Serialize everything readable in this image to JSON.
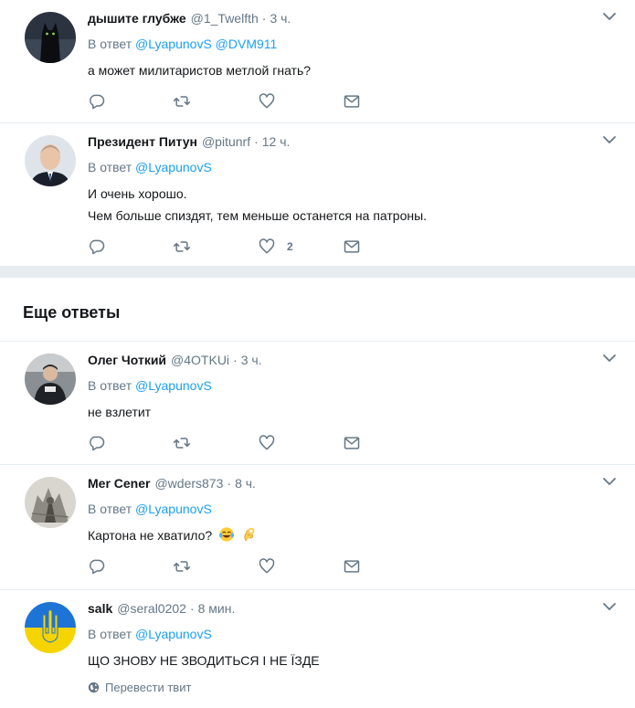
{
  "tweets_top": [
    {
      "fullname": "дышите глубже",
      "username": "@1_Twelfth",
      "time": "3 ч.",
      "reply_prefix": "В ответ",
      "mentions": [
        "@LyapunovS",
        "@DVM911"
      ],
      "text_lines": [
        "а может милитаристов метлой гнать?"
      ],
      "avatar_icon": "black-cat-avatar",
      "like_count": ""
    },
    {
      "fullname": "Президент Питун",
      "username": "@pitunrf",
      "time": "12 ч.",
      "reply_prefix": "В ответ",
      "mentions": [
        "@LyapunovS"
      ],
      "text_lines": [
        "И очень хорошо.",
        "Чем больше спиздят, тем меньше останется на патроны."
      ],
      "avatar_icon": "portrait-avatar",
      "like_count": "2"
    }
  ],
  "more_replies_title": "Еще ответы",
  "tweets_more": [
    {
      "fullname": "Олег Чоткий",
      "username": "@4OTKUi",
      "time": "3 ч.",
      "reply_prefix": "В ответ",
      "mentions": [
        "@LyapunovS"
      ],
      "text_lines": [
        "не взлетит"
      ],
      "avatar_icon": "person-photo-avatar",
      "like_count": ""
    },
    {
      "fullname": "Mer Cener",
      "username": "@wders873",
      "time": "8 ч.",
      "reply_prefix": "В ответ",
      "mentions": [
        "@LyapunovS"
      ],
      "text_lines": [
        "Картона не хватило?"
      ],
      "emojis": [
        "tears-of-joy-emoji",
        "ok-hand-emoji"
      ],
      "avatar_icon": "engraving-avatar",
      "like_count": ""
    },
    {
      "fullname": "salk",
      "username": "@seral0202",
      "time": "8 мин.",
      "reply_prefix": "В ответ",
      "mentions": [
        "@LyapunovS"
      ],
      "text_lines": [
        "ЩО ЗНОВУ НЕ ЗВОДИТЬСЯ І НЕ ЇЗДЕ"
      ],
      "avatar_icon": "ukrainian-trident-avatar",
      "translate_label": "Перевести твит"
    }
  ],
  "colors": {
    "accent": "#1da1f2",
    "secondary_text": "#657786",
    "divider": "#e6ecf0",
    "primary_text": "#14171a"
  }
}
